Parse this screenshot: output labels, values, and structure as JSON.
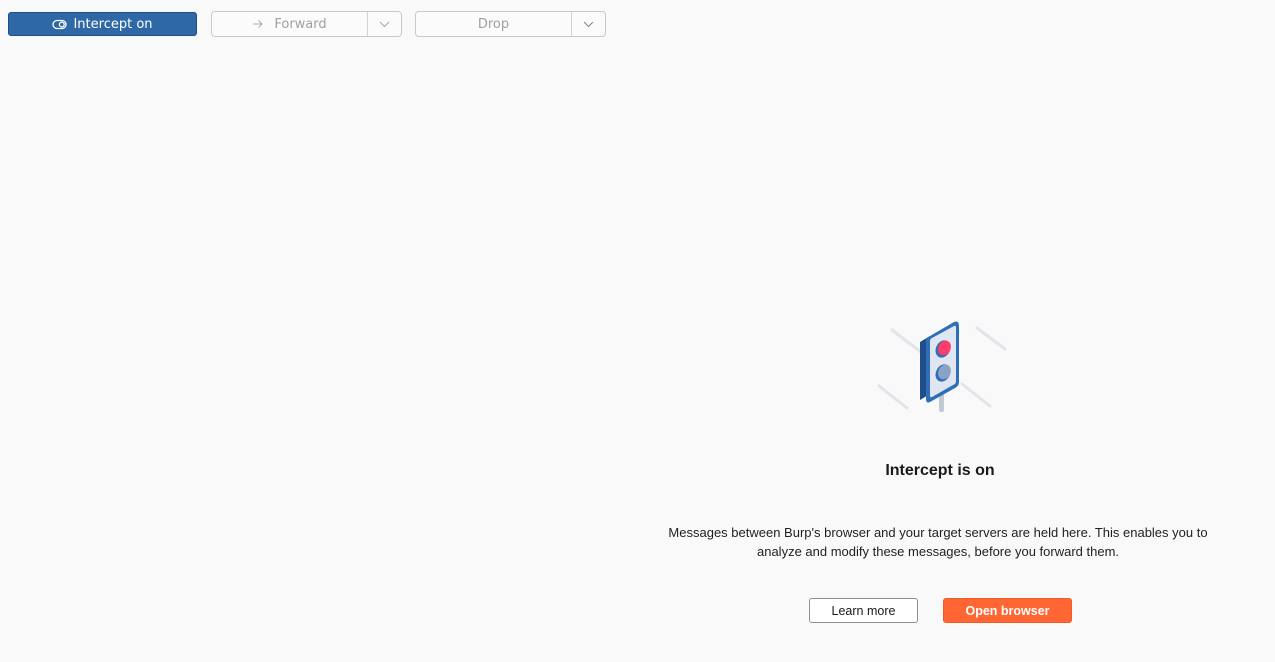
{
  "toolbar": {
    "intercept_label": "Intercept on",
    "intercept_icon": "toggle-icon",
    "forward_label": "Forward",
    "forward_icon": "arrow-right-icon",
    "drop_label": "Drop",
    "dropdown_icon": "chevron-down-icon"
  },
  "empty_state": {
    "illustration_icon": "traffic-light-icon",
    "heading": "Intercept is on",
    "description_line1": "Messages between Burp's browser and your target servers are held here. This enables you to",
    "description_line2": "analyze and modify these messages, before you forward them.",
    "learn_more_label": "Learn more",
    "open_browser_label": "Open browser"
  },
  "colors": {
    "intercept_button": "#2e68a6",
    "open_browser_button": "#ff6633",
    "background": "#f9f9f9",
    "disabled_text": "#a0a0a0"
  }
}
